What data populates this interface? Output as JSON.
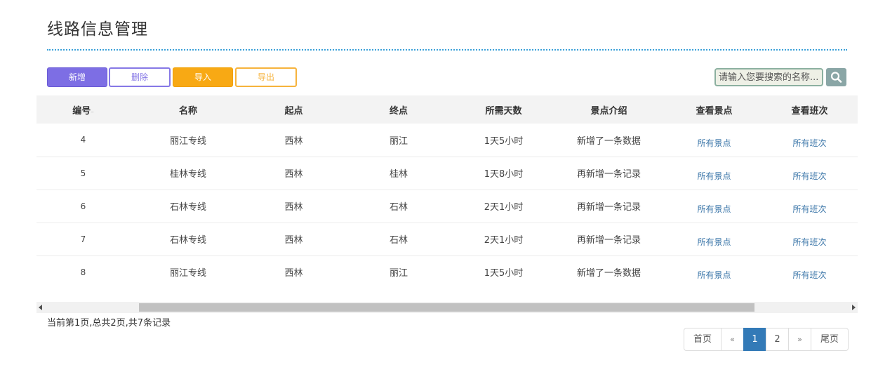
{
  "page": {
    "title": "线路信息管理"
  },
  "toolbar": {
    "add_label": "新增",
    "delete_label": "删除",
    "import_label": "导入",
    "export_label": "导出"
  },
  "search": {
    "placeholder": "请输入您要搜索的名称..."
  },
  "table": {
    "columns": [
      "编号",
      "名称",
      "起点",
      "终点",
      "所需天数",
      "景点介绍",
      "查看景点",
      "查看班次"
    ],
    "rows": [
      [
        "4",
        "丽江专线",
        "西林",
        "丽江",
        "1天5小时",
        "新增了一条数据",
        "所有景点",
        "所有班次"
      ],
      [
        "5",
        "桂林专线",
        "西林",
        "桂林",
        "1天8小时",
        "再新增一条记录",
        "所有景点",
        "所有班次"
      ],
      [
        "6",
        "石林专线",
        "西林",
        "石林",
        "2天1小时",
        "再新增一条记录",
        "所有景点",
        "所有班次"
      ],
      [
        "7",
        "石林专线",
        "西林",
        "石林",
        "2天1小时",
        "再新增一条记录",
        "所有景点",
        "所有班次"
      ],
      [
        "8",
        "丽江专线",
        "西林",
        "丽江",
        "1天5小时",
        "新增了一条数据",
        "所有景点",
        "所有班次"
      ]
    ]
  },
  "pagination": {
    "info": "当前第1页,总共2页,共7条记录",
    "first": "首页",
    "prev": "«",
    "pages": [
      "1",
      "2"
    ],
    "current": "1",
    "next": "»",
    "last": "尾页"
  },
  "colors": {
    "accent_purple": "#7d6ee4",
    "accent_orange": "#f8a914",
    "link": "#3a75a8",
    "active_page": "#337ab7"
  }
}
